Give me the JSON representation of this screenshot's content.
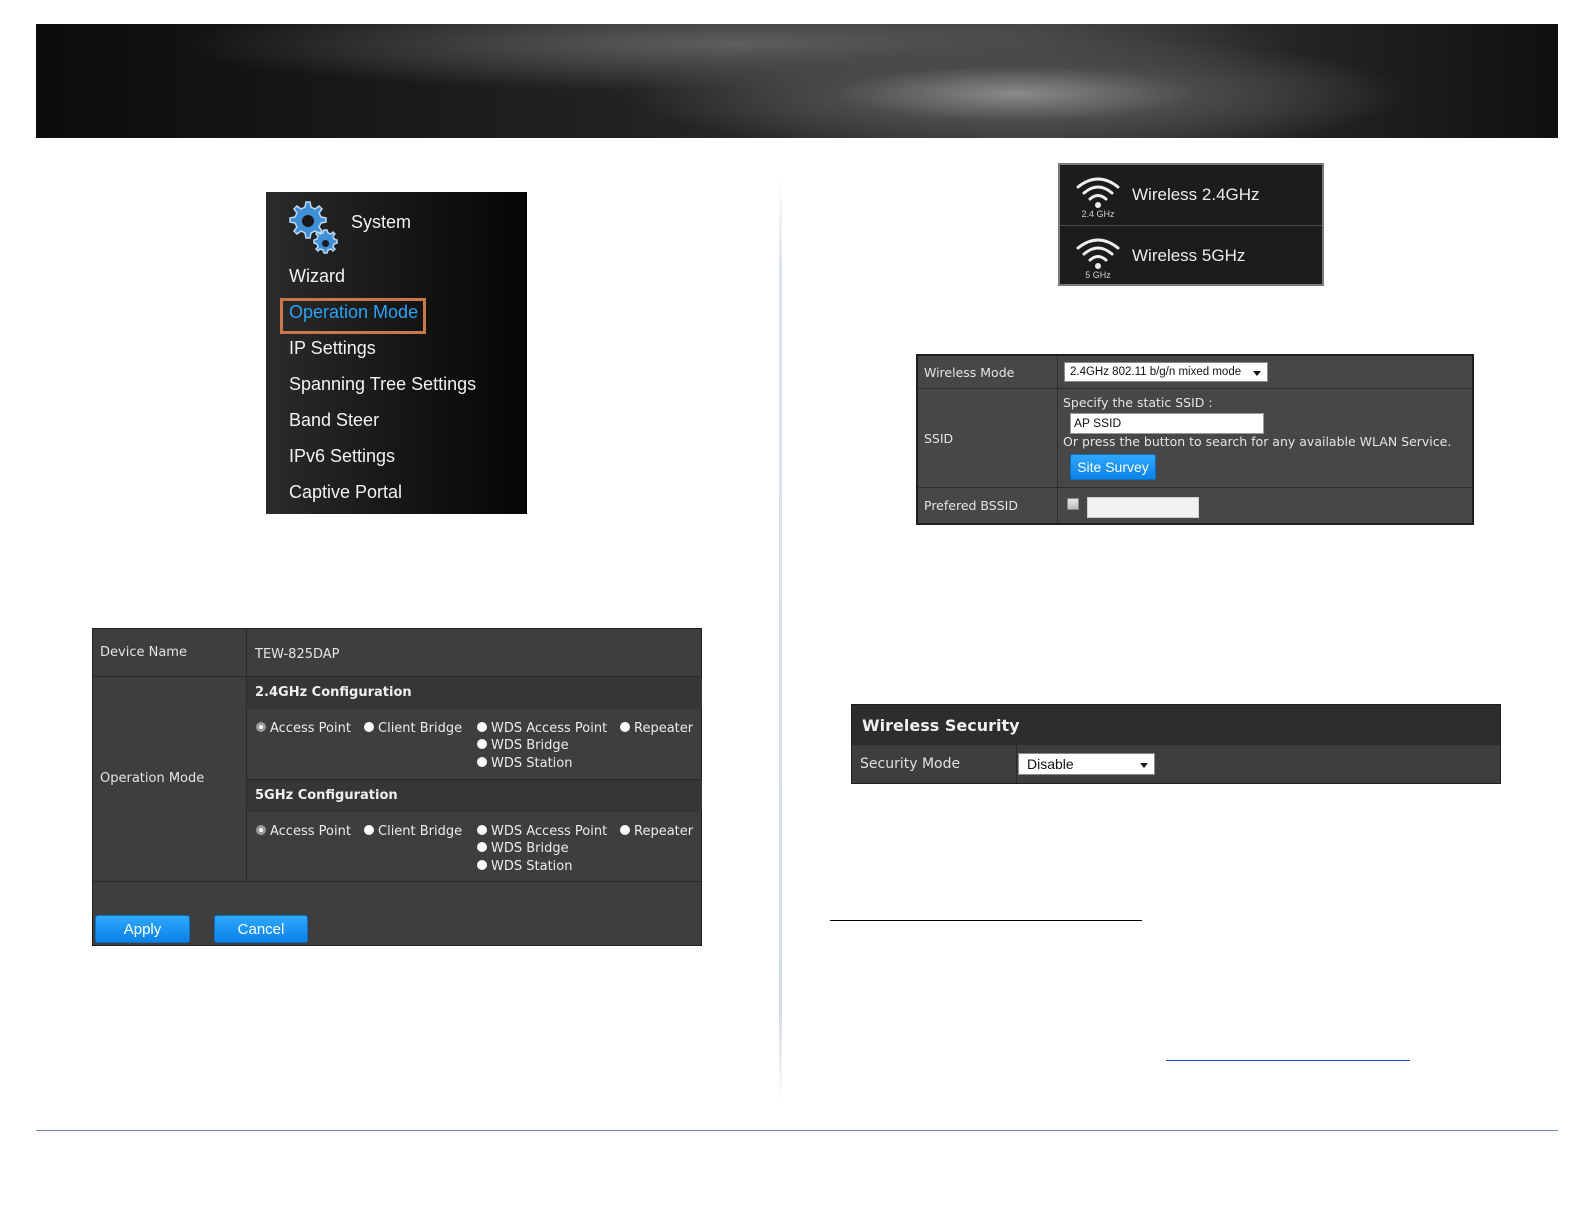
{
  "system_menu": {
    "title": "System",
    "items": [
      {
        "label": "Wizard"
      },
      {
        "label": "Operation Mode",
        "active": true
      },
      {
        "label": "IP Settings"
      },
      {
        "label": "Spanning Tree Settings"
      },
      {
        "label": "Band Steer"
      },
      {
        "label": "IPv6 Settings"
      },
      {
        "label": "Captive Portal"
      }
    ],
    "active_color": "#2aa3f4",
    "highlight_color": "#c9784a"
  },
  "band_menu": {
    "items": [
      {
        "label": "Wireless 2.4GHz",
        "icon_sub": "2.4 GHz",
        "icon": "wifi-icon"
      },
      {
        "label": "Wireless 5GHz",
        "icon_sub": "5 GHz",
        "icon": "wifi-icon"
      }
    ]
  },
  "operation_mode": {
    "device_name_label": "Device Name",
    "device_name_value": "TEW-825DAP",
    "operation_mode_label": "Operation Mode",
    "cfg24_title": "2.4GHz Configuration",
    "cfg5_title": "5GHz Configuration",
    "options": {
      "access_point": "Access Point",
      "client_bridge": "Client Bridge",
      "wds_access_point": "WDS Access Point",
      "repeater": "Repeater",
      "wds_bridge": "WDS Bridge",
      "wds_station": "WDS Station"
    },
    "selected_24": "Access Point",
    "selected_5": "Access Point",
    "apply_label": "Apply",
    "cancel_label": "Cancel"
  },
  "wireless_settings": {
    "mode_label": "Wireless Mode",
    "mode_value": "2.4GHz 802.11 b/g/n mixed mode",
    "ssid_label": "SSID",
    "ssid_hint": "Specify the static SSID :",
    "ssid_value": "AP SSID",
    "ssid_search_hint": "Or press the button to search for any available WLAN Service.",
    "site_survey_label": "Site Survey",
    "bssid_label": "Prefered BSSID",
    "bssid_value": ""
  },
  "wireless_security": {
    "title": "Wireless Security",
    "mode_label": "Security Mode",
    "mode_value": "Disable"
  }
}
